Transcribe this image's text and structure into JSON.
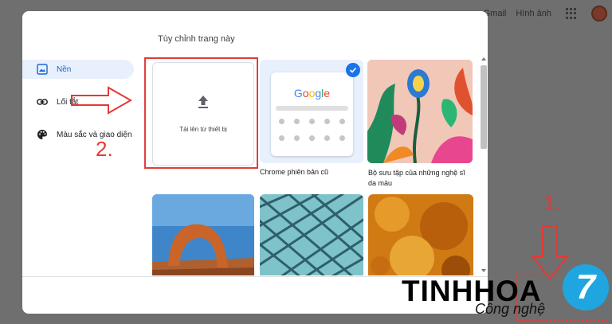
{
  "topbar": {
    "gmail": "Gmail",
    "images": "Hình ảnh"
  },
  "dialog": {
    "title": "Tùy chỉnh trang này",
    "nav": [
      {
        "label": "Nền",
        "icon": "image-icon",
        "active": true
      },
      {
        "label": "Lối tắt",
        "icon": "link-icon",
        "active": false
      },
      {
        "label": "Màu sắc và giao diện",
        "icon": "palette-icon",
        "active": false
      }
    ],
    "upload_label": "Tải lên từ thiết bị",
    "google_logo": "Google",
    "captions": {
      "chrome_classic": "Chrome phiên bản cũ",
      "art_collection": "Bộ sưu tập của những nghệ sĩ da màu"
    }
  },
  "annotations": {
    "step2": "2.",
    "step1": "1."
  },
  "watermark": {
    "brand": "TINHHOA",
    "sub": "Công nghệ",
    "badge": "7"
  },
  "colors": {
    "accent": "#1a73e8",
    "active_bg": "#e8f0fe",
    "annotation": "#e53935"
  }
}
